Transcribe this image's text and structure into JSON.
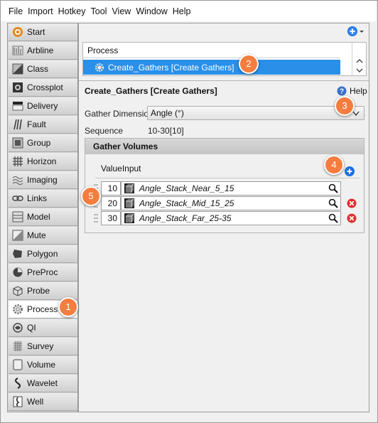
{
  "menu": [
    "File",
    "Import",
    "Hotkey",
    "Tool",
    "View",
    "Window",
    "Help"
  ],
  "sidebar": {
    "items": [
      {
        "label": "Start",
        "icon": "start-icon"
      },
      {
        "label": "Arbline",
        "icon": "arbline-icon"
      },
      {
        "label": "Class",
        "icon": "class-icon"
      },
      {
        "label": "Crossplot",
        "icon": "crossplot-icon"
      },
      {
        "label": "Delivery",
        "icon": "delivery-icon"
      },
      {
        "label": "Fault",
        "icon": "fault-icon"
      },
      {
        "label": "Group",
        "icon": "group-icon"
      },
      {
        "label": "Horizon",
        "icon": "horizon-icon"
      },
      {
        "label": "Imaging",
        "icon": "imaging-icon"
      },
      {
        "label": "Links",
        "icon": "links-icon"
      },
      {
        "label": "Model",
        "icon": "model-icon"
      },
      {
        "label": "Mute",
        "icon": "mute-icon"
      },
      {
        "label": "Polygon",
        "icon": "polygon-icon"
      },
      {
        "label": "PreProc",
        "icon": "preproc-icon"
      },
      {
        "label": "Probe",
        "icon": "probe-icon"
      },
      {
        "label": "Process",
        "icon": "gear-icon",
        "active": true
      },
      {
        "label": "QI",
        "icon": "qi-icon"
      },
      {
        "label": "Survey",
        "icon": "survey-icon"
      },
      {
        "label": "Volume",
        "icon": "volume-icon"
      },
      {
        "label": "Wavelet",
        "icon": "wavelet-icon"
      },
      {
        "label": "Well",
        "icon": "well-icon"
      }
    ]
  },
  "process_list": {
    "header": "Process",
    "selected_item": "Create_Gathers [Create Gathers]"
  },
  "details": {
    "title": "Create_Gathers [Create Gathers]",
    "help_label": "Help",
    "gather_dimension_label": "Gather Dimension",
    "gather_dimension_value": "Angle (°)",
    "sequence_label": "Sequence",
    "sequence_value": "10-30[10]"
  },
  "gather_volumes": {
    "header": "Gather Volumes",
    "col_value": "Value",
    "col_input": "Input",
    "rows": [
      {
        "value": "10",
        "input": "Angle_Stack_Near_5_15",
        "deletable": false
      },
      {
        "value": "20",
        "input": "Angle_Stack_Mid_15_25",
        "deletable": true
      },
      {
        "value": "30",
        "input": "Angle_Stack_Far_25-35",
        "deletable": true
      }
    ]
  },
  "callouts": [
    "1",
    "2",
    "3",
    "4",
    "5"
  ],
  "colors": {
    "selection": "#2a8fe8",
    "callout": "#f47d3f",
    "add": "#1e6fe0",
    "delete": "#e03030"
  }
}
